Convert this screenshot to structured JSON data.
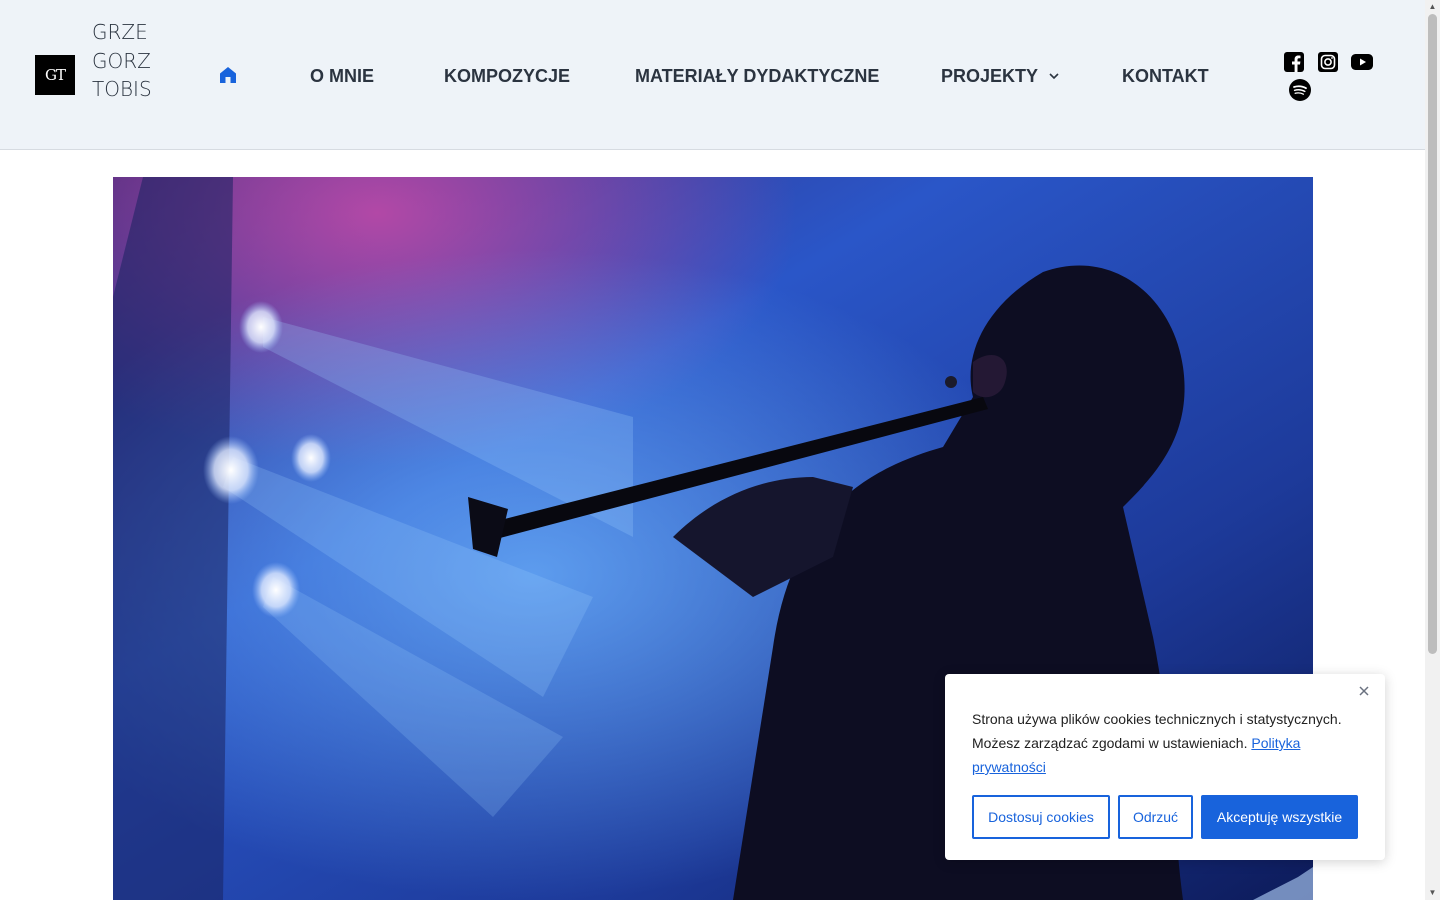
{
  "header": {
    "logo_text": "GT",
    "site_title": "GRZEGORZTOBIS"
  },
  "nav": {
    "items": [
      {
        "label": "O MNIE"
      },
      {
        "label": "KOMPOZYCJE"
      },
      {
        "label": "MATERIAŁY DYDAKTYCZNE"
      },
      {
        "label": "PROJEKTY"
      },
      {
        "label": "KONTAKT"
      }
    ],
    "active_color": "#1863dc",
    "text_color": "#2b3440"
  },
  "social": {
    "icons": [
      "facebook-icon",
      "instagram-icon",
      "youtube-icon",
      "spotify-icon"
    ]
  },
  "hero": {
    "image": "clarinet-player-on-stage"
  },
  "cookie": {
    "text": "Strona używa plików cookies technicznych i statystycznych. Możesz zarządzać zgodami w ustawieniach.",
    "link": "Polityka prywatności",
    "customize": "Dostosuj cookies",
    "reject": "Odrzuć",
    "accept": "Akceptuję wszystkie",
    "accent": "#1863dc"
  }
}
